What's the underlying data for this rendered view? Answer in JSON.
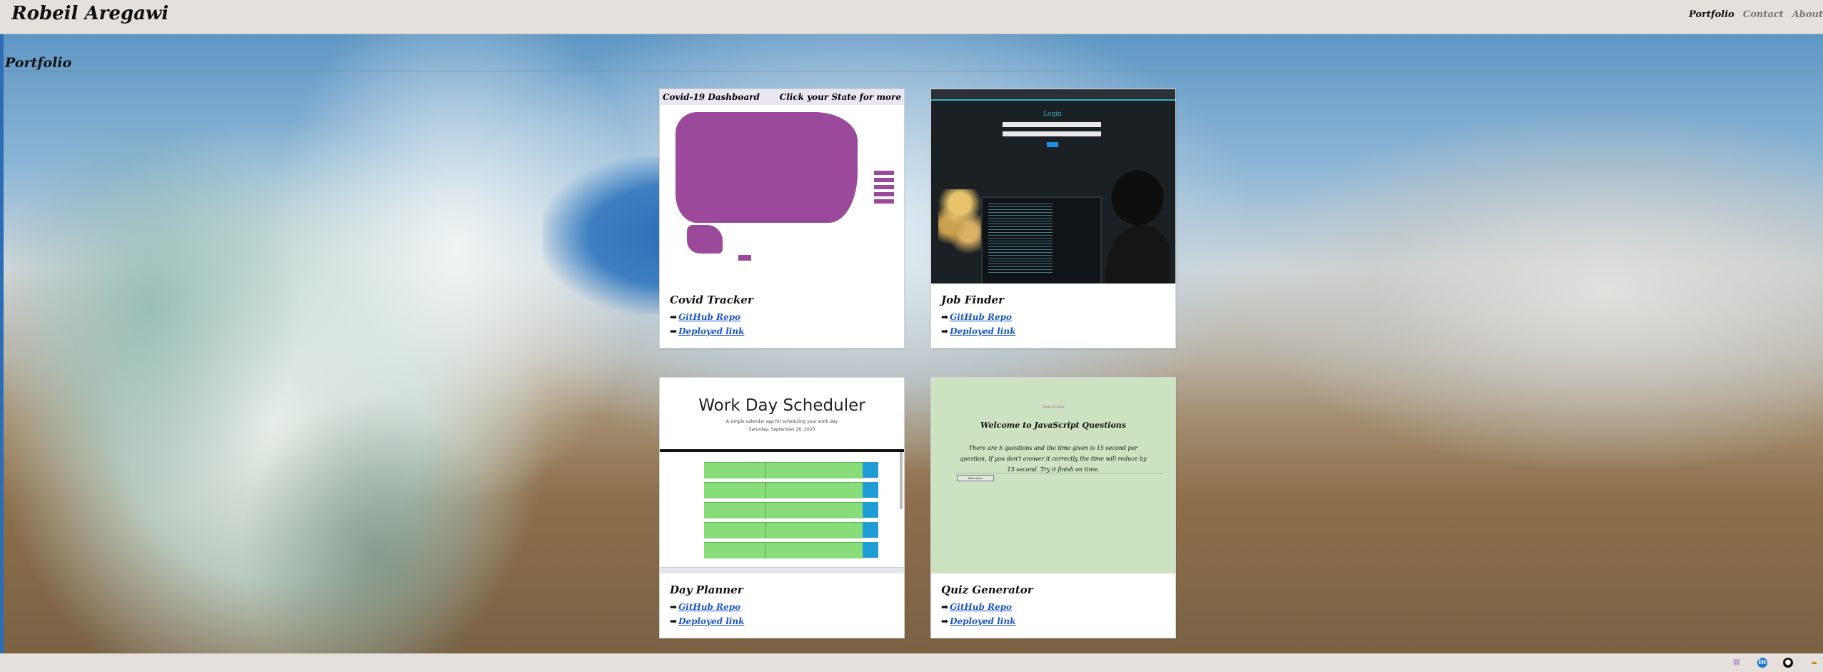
{
  "header": {
    "brand": "Robeil Aregawi",
    "nav": [
      "Portfolio",
      "Contact",
      "About"
    ]
  },
  "page": {
    "title": "Portfolio"
  },
  "cards": [
    {
      "name": "Covid Tracker",
      "repo_label": "GitHub Repo",
      "deploy_label": "Deployed link",
      "thumb": {
        "left_text": "Covid-19 Dashboard",
        "right_text": "Click your State for more"
      }
    },
    {
      "name": "Job Finder",
      "repo_label": "GitHub Repo",
      "deploy_label": "Deployed link",
      "thumb": {
        "heading": "Login"
      }
    },
    {
      "name": "Day Planner",
      "repo_label": "GitHub Repo",
      "deploy_label": "Deployed link",
      "thumb": {
        "title": "Work Day Scheduler",
        "subtitle": "A simple calendar app for scheduling your work day",
        "date": "Saturday, September 26, 2020"
      }
    },
    {
      "name": "Quiz Generator",
      "repo_label": "GitHub Repo",
      "deploy_label": "Deployed link",
      "thumb": {
        "link": "View Scores",
        "title": "Welcome to JavaScript Questions",
        "text": "There are 5 questions and the time given is 15 second per question. If you don't answer it correctly the time will reduce by 15 second. Try it finish on time.",
        "button": "Start Quiz"
      }
    }
  ],
  "footer": {
    "icons": [
      "document-icon",
      "linkedin-icon",
      "github-icon",
      "cloud-icon"
    ]
  },
  "colors": {
    "header_bg": "#e6e0dc",
    "link": "#1a56c4",
    "covid_map": "#9b4a9b",
    "planner_rows": "#88dd7a",
    "quiz_bg": "#cde2c0"
  }
}
